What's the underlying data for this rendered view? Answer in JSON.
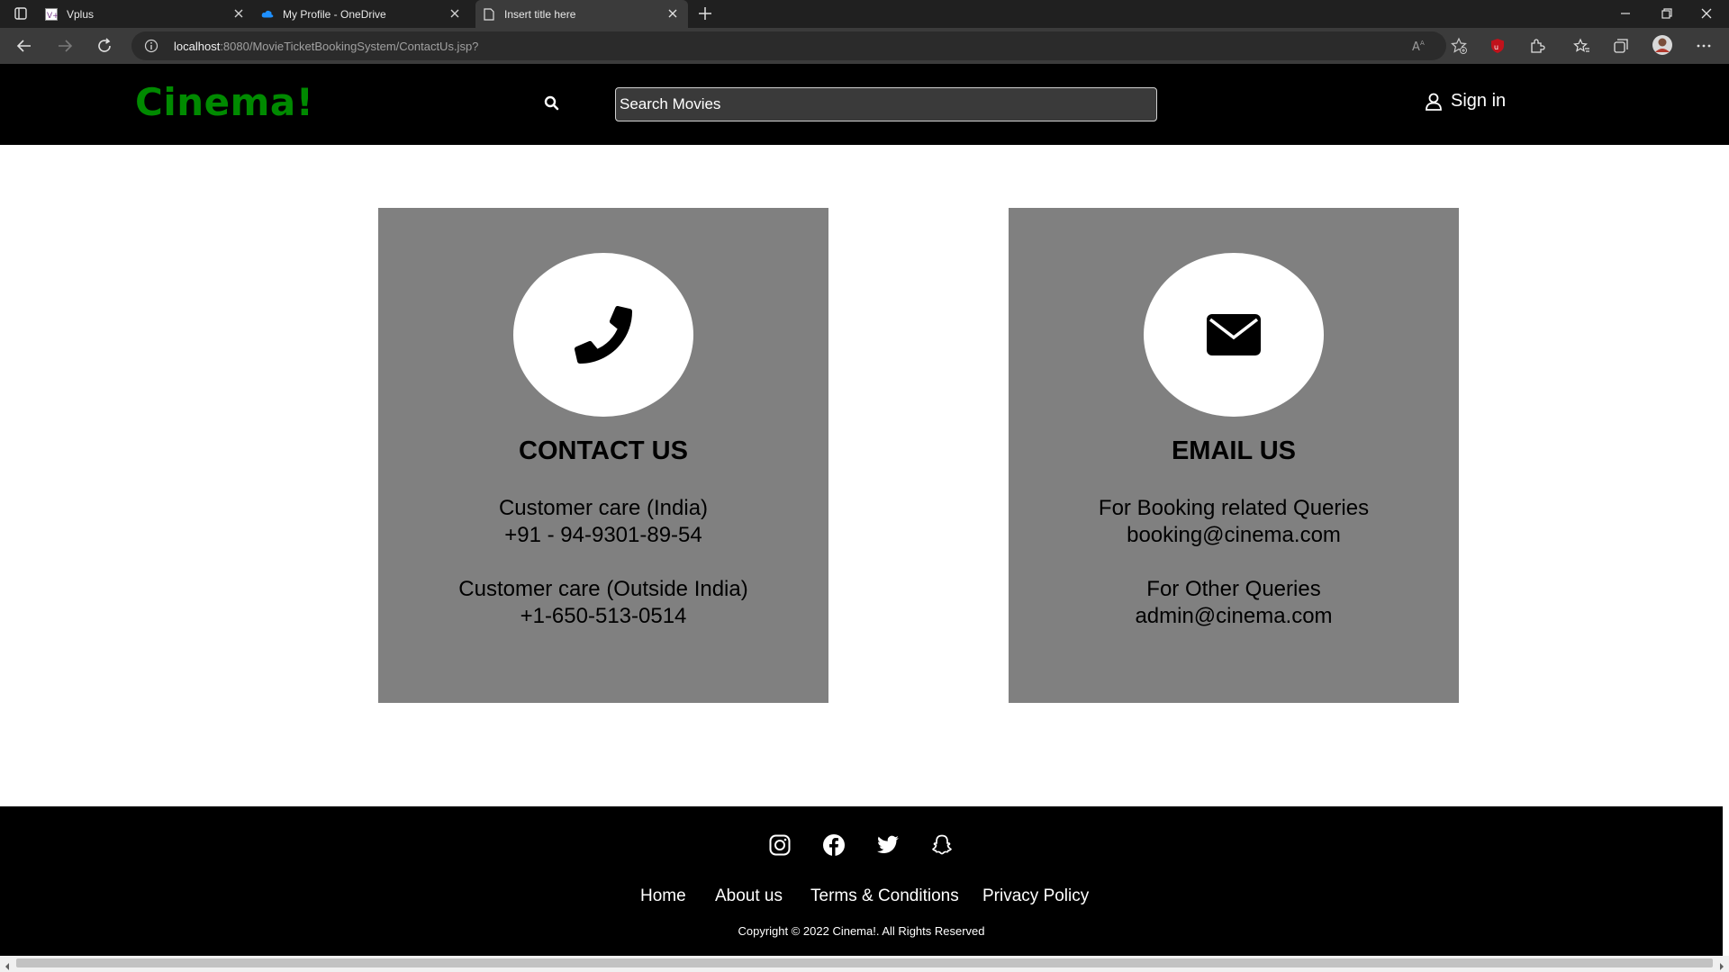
{
  "browser": {
    "tabs": [
      {
        "label": "Vplus",
        "icon": "vplus-favicon",
        "active": false
      },
      {
        "label": "My Profile - OneDrive",
        "icon": "onedrive-cloud-icon",
        "active": false
      },
      {
        "label": "Insert title here",
        "icon": "page-icon",
        "active": true
      }
    ],
    "url_host": "localhost",
    "url_path": ":8080/MovieTicketBookingSystem/ContactUs.jsp?"
  },
  "header": {
    "logo": "Cinema!",
    "logo_color": "#008a00",
    "search_placeholder": "Search Movies",
    "signin_label": "Sign in"
  },
  "contact_card": {
    "icon": "phone-icon",
    "title": "CONTACT US",
    "line1": "Customer care (India)",
    "line2": "+91 - 94-9301-89-54",
    "line3": "Customer care (Outside India)",
    "line4": "+1-650-513-0514"
  },
  "email_card": {
    "icon": "envelope-icon",
    "title": "EMAIL US",
    "line1": "For Booking related Queries",
    "line2": "booking@cinema.com",
    "line3": "For Other Queries",
    "line4": "admin@cinema.com"
  },
  "footer": {
    "social_icons": [
      "instagram-icon",
      "facebook-icon",
      "twitter-icon",
      "snapchat-icon"
    ],
    "links": [
      "Home",
      "About us",
      "Terms & Conditions",
      "Privacy Policy"
    ],
    "copyright": "Copyright © 2022 Cinema!. All Rights Reserved"
  }
}
